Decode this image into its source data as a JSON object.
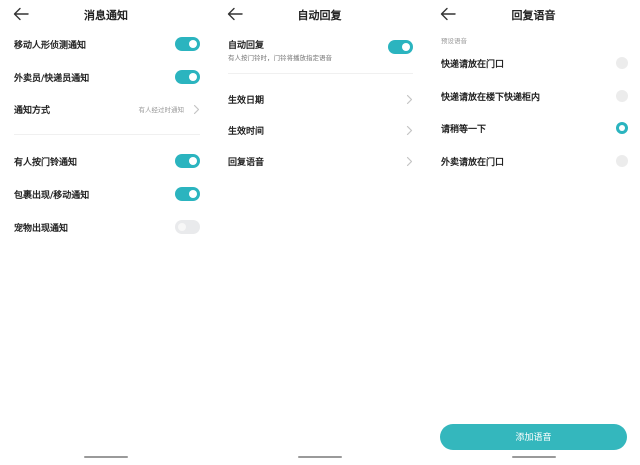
{
  "colors": {
    "accent": "#2bb4bf",
    "button": "#34b7bd",
    "toggle_off": "#e9eaec"
  },
  "panel1": {
    "title": "消息通知",
    "items": [
      {
        "label": "移动人形侦测通知",
        "type": "toggle",
        "on": true
      },
      {
        "label": "外卖员/快递员通知",
        "type": "toggle",
        "on": true
      },
      {
        "label": "通知方式",
        "type": "select",
        "value": "有人经过时通知"
      },
      {
        "label": "有人按门铃通知",
        "type": "toggle",
        "on": true
      },
      {
        "label": "包裹出现/移动通知",
        "type": "toggle",
        "on": true
      },
      {
        "label": "宠物出现通知",
        "type": "toggle",
        "on": false
      }
    ]
  },
  "panel2": {
    "title": "自动回复",
    "auto_reply": {
      "label": "自动回复",
      "description": "有人按门铃时，门铃将播放指定语音",
      "on": true
    },
    "items": [
      {
        "label": "生效日期"
      },
      {
        "label": "生效时间"
      },
      {
        "label": "回复语音"
      }
    ]
  },
  "panel3": {
    "title": "回复语音",
    "section_label": "预设语音",
    "options": [
      {
        "label": "快递请放在门口",
        "selected": false
      },
      {
        "label": "快递请放在楼下快递柜内",
        "selected": false
      },
      {
        "label": "请稍等一下",
        "selected": true
      },
      {
        "label": "外卖请放在门口",
        "selected": false
      }
    ],
    "add_button": "添加语音"
  },
  "icons": {
    "back": "arrow-left-icon",
    "chevron": "chevron-right-icon"
  }
}
